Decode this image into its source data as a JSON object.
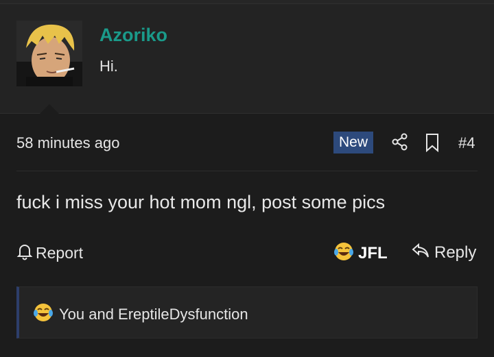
{
  "post": {
    "author": {
      "name": "Azoriko",
      "title": "Hi.",
      "name_color": "#1a9a8a"
    },
    "timestamp": "58 minutes ago",
    "badge": "New",
    "badge_color": "#2d4a7c",
    "post_number": "#4",
    "message": "fuck i miss your hot mom ngl, post some pics",
    "actions": {
      "report_label": "Report",
      "reaction_label": "JFL",
      "reply_label": "Reply"
    },
    "reactions_summary": "You and EreptileDysfunction",
    "icons": [
      "share-icon",
      "bookmark-icon",
      "bell-icon",
      "laughing-crying-emoji-icon",
      "reply-arrow-icon"
    ]
  }
}
